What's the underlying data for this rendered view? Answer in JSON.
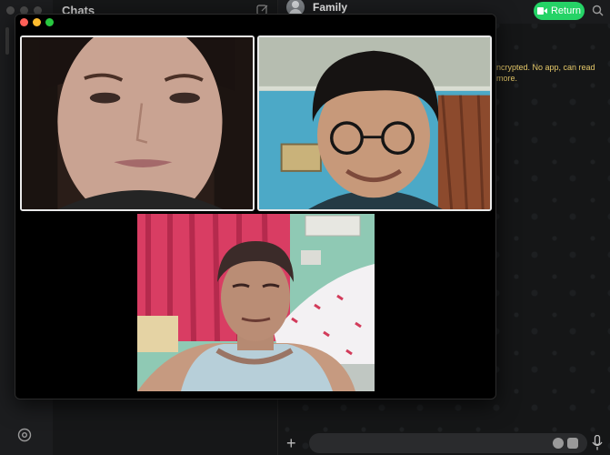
{
  "sidebar": {
    "title": "Chats"
  },
  "chat": {
    "contact_name": "Family",
    "return_label": "Return",
    "encryption_notice": "ncrypted. No app, can read more."
  },
  "composer": {
    "add_label": "+"
  },
  "call": {
    "participants": [
      {
        "id": "participant-1",
        "tile_color": "#c9a89a"
      },
      {
        "id": "participant-2",
        "tile_color": "#47a6c4"
      },
      {
        "id": "participant-3",
        "tile_color": "#e0456a"
      }
    ]
  },
  "colors": {
    "accent_green": "#25d366",
    "notice_yellow": "#e6c96a",
    "close": "#fe5f57",
    "minimize": "#febc2e",
    "maximize": "#28c840"
  }
}
